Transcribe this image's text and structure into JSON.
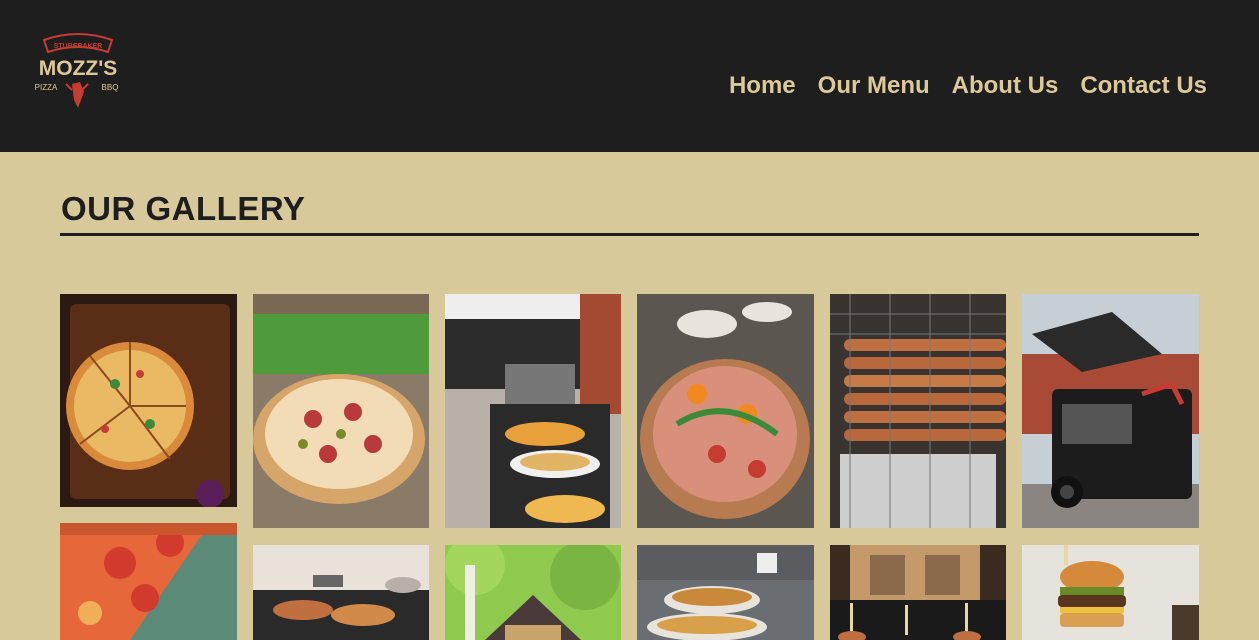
{
  "brand": {
    "top_text": "STUBERAKER",
    "name": "MOZZ'S",
    "left_tag": "PIZZA",
    "right_tag": "BBQ",
    "logo_color": "#c63b32"
  },
  "nav": {
    "items": [
      "Home",
      "Our Menu",
      "About Us",
      "Contact Us"
    ],
    "color": "#dcc99a"
  },
  "gallery": {
    "title": "OUR GALLERY"
  },
  "colors": {
    "header_bg": "#1e1e1e",
    "page_bg": "#d8c99b"
  }
}
